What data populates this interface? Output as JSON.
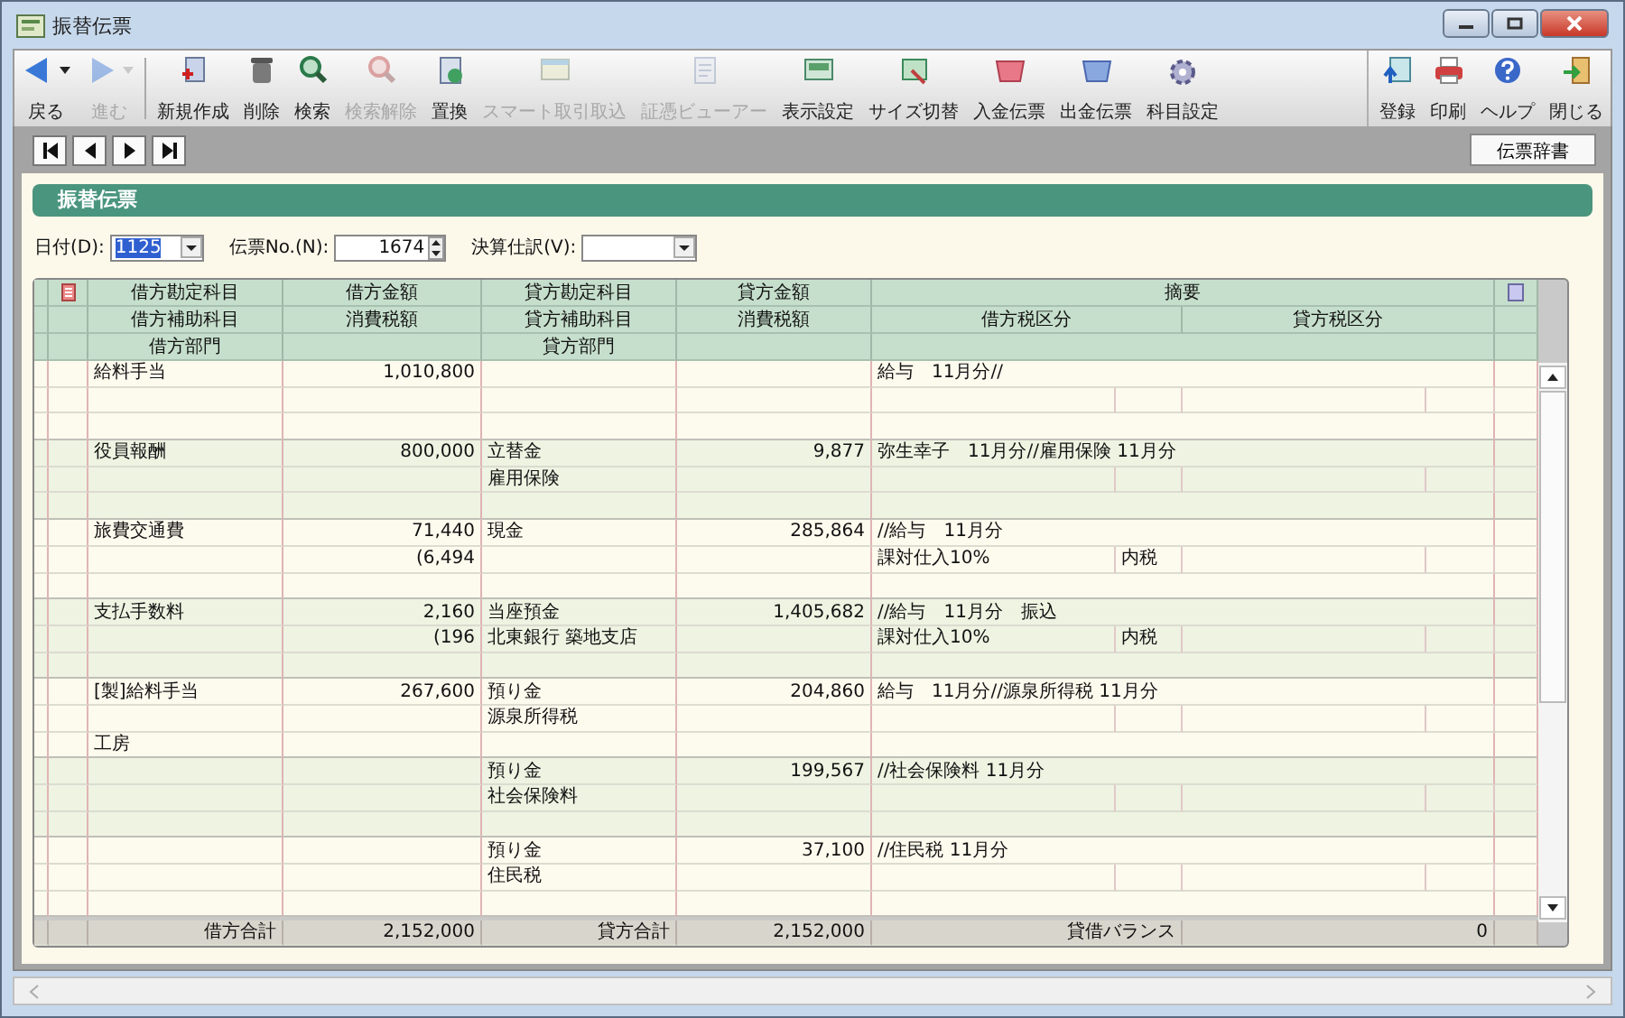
{
  "window": {
    "title": "振替伝票"
  },
  "toolbar": {
    "main": [
      {
        "label": "戻る",
        "disabled": false,
        "dropdown": true
      },
      {
        "label": "進む",
        "disabled": true,
        "dropdown": true
      },
      {
        "label": "新規作成",
        "disabled": false,
        "dropdown": false
      },
      {
        "label": "削除",
        "disabled": false,
        "dropdown": false
      },
      {
        "label": "検索",
        "disabled": false,
        "dropdown": false
      },
      {
        "label": "検索解除",
        "disabled": true,
        "dropdown": false
      },
      {
        "label": "置換",
        "disabled": false,
        "dropdown": false
      },
      {
        "label": "スマート取引取込",
        "disabled": true,
        "dropdown": false
      },
      {
        "label": "証憑ビューアー",
        "disabled": true,
        "dropdown": false
      },
      {
        "label": "表示設定",
        "disabled": false,
        "dropdown": false
      },
      {
        "label": "サイズ切替",
        "disabled": false,
        "dropdown": false
      },
      {
        "label": "入金伝票",
        "disabled": false,
        "dropdown": false
      },
      {
        "label": "出金伝票",
        "disabled": false,
        "dropdown": false
      },
      {
        "label": "科目設定",
        "disabled": false,
        "dropdown": false
      }
    ],
    "right": [
      {
        "label": "登録",
        "disabled": false,
        "dropdown": false
      },
      {
        "label": "印刷",
        "disabled": false,
        "dropdown": false
      },
      {
        "label": "ヘルプ",
        "disabled": false,
        "dropdown": false
      },
      {
        "label": "閉じる",
        "disabled": false,
        "dropdown": false
      }
    ]
  },
  "dictionary_button": "伝票辞書",
  "section_title": "振替伝票",
  "form": [
    {
      "label": "日付(D):",
      "value": "1125",
      "kind": "dropdown",
      "text_selected": true
    },
    {
      "label": "伝票No.(N):",
      "value": "1674",
      "kind": "spinner",
      "text_selected": false
    },
    {
      "label": "決算仕訳(V):",
      "kind": "dropdown"
    }
  ],
  "table": {
    "header_rows": [
      [
        "借方勘定科目",
        "借方金額",
        "貸方勘定科目",
        "貸方金額",
        "摘要"
      ],
      [
        "借方補助科目",
        "消費税額",
        "貸方補助科目",
        "消費税額",
        "借方税区分",
        "貸方税区分"
      ],
      [
        "借方部門",
        "貸方部門"
      ]
    ],
    "entries": [
      {
        "debit_account": "給料手当",
        "debit_amount": "1,010,800",
        "summary": "給与　11月分//"
      },
      {
        "debit_account": "役員報酬",
        "debit_amount": "800,000",
        "credit_account": "立替金",
        "credit_amount": "9,877",
        "summary": "弥生幸子　11月分//雇用保険 11月分",
        "credit_sub": "雇用保険"
      },
      {
        "debit_account": "旅費交通費",
        "debit_amount": "71,440",
        "credit_account": "現金",
        "credit_amount": "285,864",
        "summary": "//給与　11月分",
        "debit_tax": "(6,494",
        "debit_tax_type": "課対仕入10%",
        "debit_tax_method": "内税"
      },
      {
        "debit_account": "支払手数料",
        "debit_amount": "2,160",
        "credit_account": "当座預金",
        "credit_amount": "1,405,682",
        "summary": "//給与　11月分　振込",
        "debit_tax": "(196",
        "credit_sub": "北東銀行 築地支店",
        "debit_tax_type": "課対仕入10%",
        "debit_tax_method": "内税"
      },
      {
        "debit_account": "[製]給料手当",
        "debit_amount": "267,600",
        "credit_account": "預り金",
        "credit_amount": "204,860",
        "summary": "給与　11月分//源泉所得税 11月分",
        "credit_sub": "源泉所得税",
        "debit_dept": "工房"
      },
      {
        "credit_account": "預り金",
        "credit_amount": "199,567",
        "summary": "//社会保険料 11月分",
        "credit_sub": "社会保険料"
      },
      {
        "credit_account": "預り金",
        "credit_amount": "37,100",
        "summary": "//住民税 11月分",
        "credit_sub": "住民税"
      }
    ],
    "totals": {
      "debit_label": "借方合計",
      "debit_total": "2,152,000",
      "credit_label": "貸方合計",
      "credit_total": "2,152,000",
      "balance_label": "貸借バランス",
      "balance": "0"
    }
  }
}
